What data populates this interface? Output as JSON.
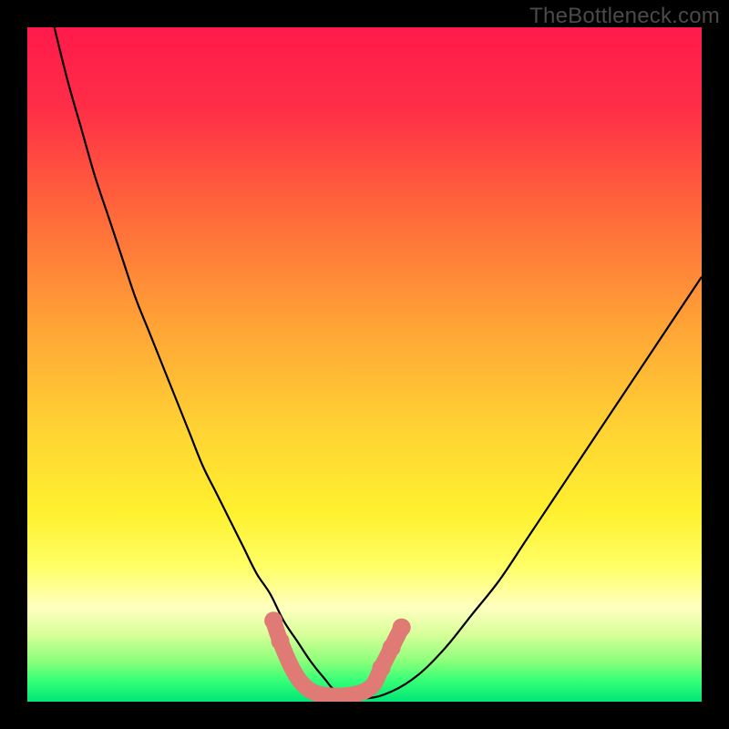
{
  "watermark": "TheBottleneck.com",
  "chart_data": {
    "type": "line",
    "title": "",
    "xlabel": "",
    "ylabel": "",
    "xlim": [
      0,
      100
    ],
    "ylim": [
      0,
      100
    ],
    "background_gradient_stops": [
      {
        "offset": 0.0,
        "color": "#ff1a4b"
      },
      {
        "offset": 0.12,
        "color": "#ff2e47"
      },
      {
        "offset": 0.28,
        "color": "#ff6a3a"
      },
      {
        "offset": 0.45,
        "color": "#ffa636"
      },
      {
        "offset": 0.6,
        "color": "#ffd433"
      },
      {
        "offset": 0.72,
        "color": "#fff12f"
      },
      {
        "offset": 0.8,
        "color": "#ffff66"
      },
      {
        "offset": 0.86,
        "color": "#ffffc0"
      },
      {
        "offset": 0.9,
        "color": "#d8ff9a"
      },
      {
        "offset": 0.94,
        "color": "#8cff7a"
      },
      {
        "offset": 0.97,
        "color": "#33ff77"
      },
      {
        "offset": 1.0,
        "color": "#00e676"
      }
    ],
    "series": [
      {
        "name": "bottleneck-curve",
        "color": "#000000",
        "stroke_width": 2.2,
        "x": [
          4,
          6,
          8,
          10,
          12,
          14,
          16,
          18,
          20,
          22,
          24,
          26,
          28,
          30,
          32,
          34,
          36,
          38,
          40,
          42,
          44,
          46,
          50,
          54,
          58,
          62,
          66,
          70,
          74,
          78,
          82,
          86,
          90,
          94,
          98,
          100
        ],
        "y": [
          100,
          92,
          85,
          78,
          72,
          66,
          60,
          55,
          50,
          45,
          40,
          35,
          31,
          27,
          23,
          19,
          16,
          12,
          9,
          6,
          3.5,
          1.5,
          0.5,
          1.5,
          4,
          8,
          13,
          18,
          24,
          30,
          36,
          42,
          48,
          54,
          60,
          63
        ]
      },
      {
        "name": "marker-ribbon",
        "color": "#e07a74",
        "stroke_width": 18,
        "linecap": "round",
        "x": [
          36.5,
          37.5,
          39.5,
          41.5,
          44,
          48,
          51,
          52.5,
          54,
          55.5
        ],
        "y": [
          12,
          9,
          4.5,
          2,
          1,
          1,
          2.2,
          5,
          8,
          11
        ]
      }
    ],
    "marker_dots": {
      "color": "#e07a74",
      "radius": 10,
      "points": [
        {
          "x": 36.5,
          "y": 12
        },
        {
          "x": 37.5,
          "y": 9
        },
        {
          "x": 52.5,
          "y": 5
        },
        {
          "x": 54.0,
          "y": 8
        },
        {
          "x": 55.5,
          "y": 11
        }
      ]
    }
  }
}
